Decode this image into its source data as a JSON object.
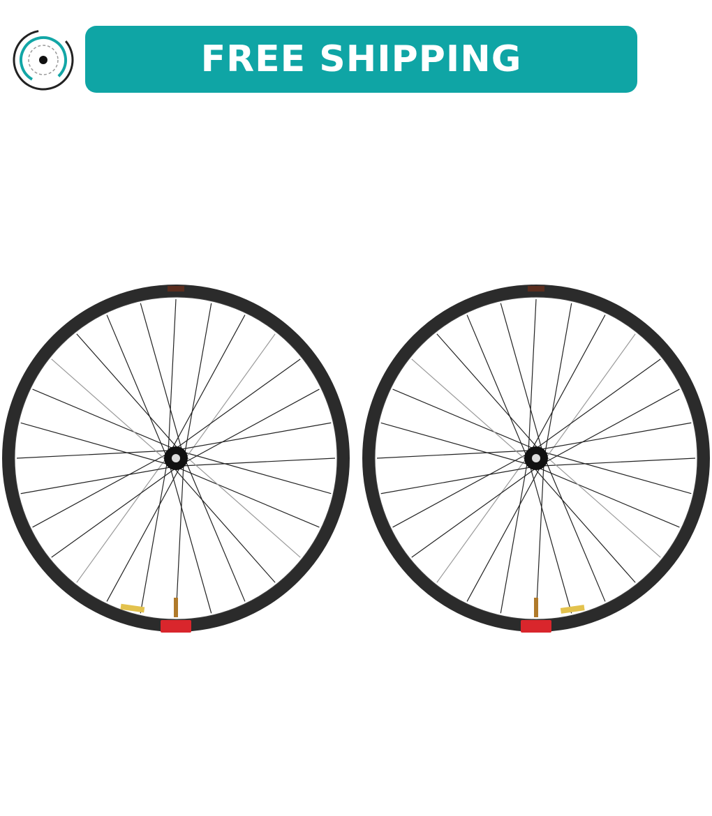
{
  "banner": {
    "text": "FREE SHIPPING",
    "background_color": "#0fa5a5",
    "text_color": "#ffffff"
  },
  "logo": {
    "icon": "concentric-circle-logo-icon",
    "accent_color": "#12a6a6"
  },
  "product": {
    "wheel_count": 2,
    "spokes_per_wheel": 28,
    "rim_color": "#2b2b2b",
    "decal_color": "#d9262c"
  }
}
